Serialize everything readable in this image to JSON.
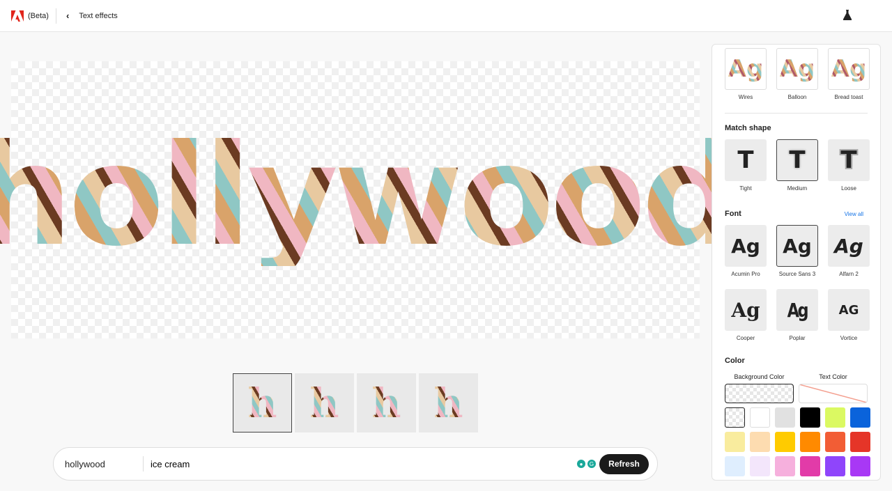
{
  "header": {
    "beta": "(Beta)",
    "back_icon": "chevron-left",
    "title": "Text effects",
    "lab_icon": "flask"
  },
  "canvas": {
    "text": "hollywood"
  },
  "variations": [
    "h",
    "h",
    "h",
    "h"
  ],
  "prompt": {
    "text": "hollywood",
    "style": "ice cream",
    "refresh": "Refresh"
  },
  "panel": {
    "styles": [
      {
        "label": "Wires"
      },
      {
        "label": "Balloon"
      },
      {
        "label": "Bread toast"
      }
    ],
    "sample": "Ag",
    "match_shape": {
      "title": "Match shape",
      "glyph": "T",
      "items": [
        {
          "label": "Tight"
        },
        {
          "label": "Medium",
          "selected": true
        },
        {
          "label": "Loose"
        }
      ]
    },
    "font": {
      "title": "Font",
      "view_all": "View all",
      "items": [
        {
          "label": "Acumin Pro"
        },
        {
          "label": "Source Sans 3",
          "selected": true
        },
        {
          "label": "Alfarn 2"
        },
        {
          "label": "Cooper"
        },
        {
          "label": "Poplar"
        },
        {
          "label": "Vortice"
        }
      ]
    },
    "color": {
      "title": "Color",
      "background_label": "Background Color",
      "text_label": "Text Color",
      "swatches": [
        "transparent",
        "#ffffff",
        "#e1e1e1",
        "#000000",
        "#dbf962",
        "#0a63db",
        "#f9ec9e",
        "#fddcb0",
        "#ffcb00",
        "#ff8a00",
        "#f25d35",
        "#e53528",
        "#dfeefe",
        "#f3e6fb",
        "#f6b0dd",
        "#e23ba8",
        "#8f45fb",
        "#a838f5"
      ]
    }
  }
}
